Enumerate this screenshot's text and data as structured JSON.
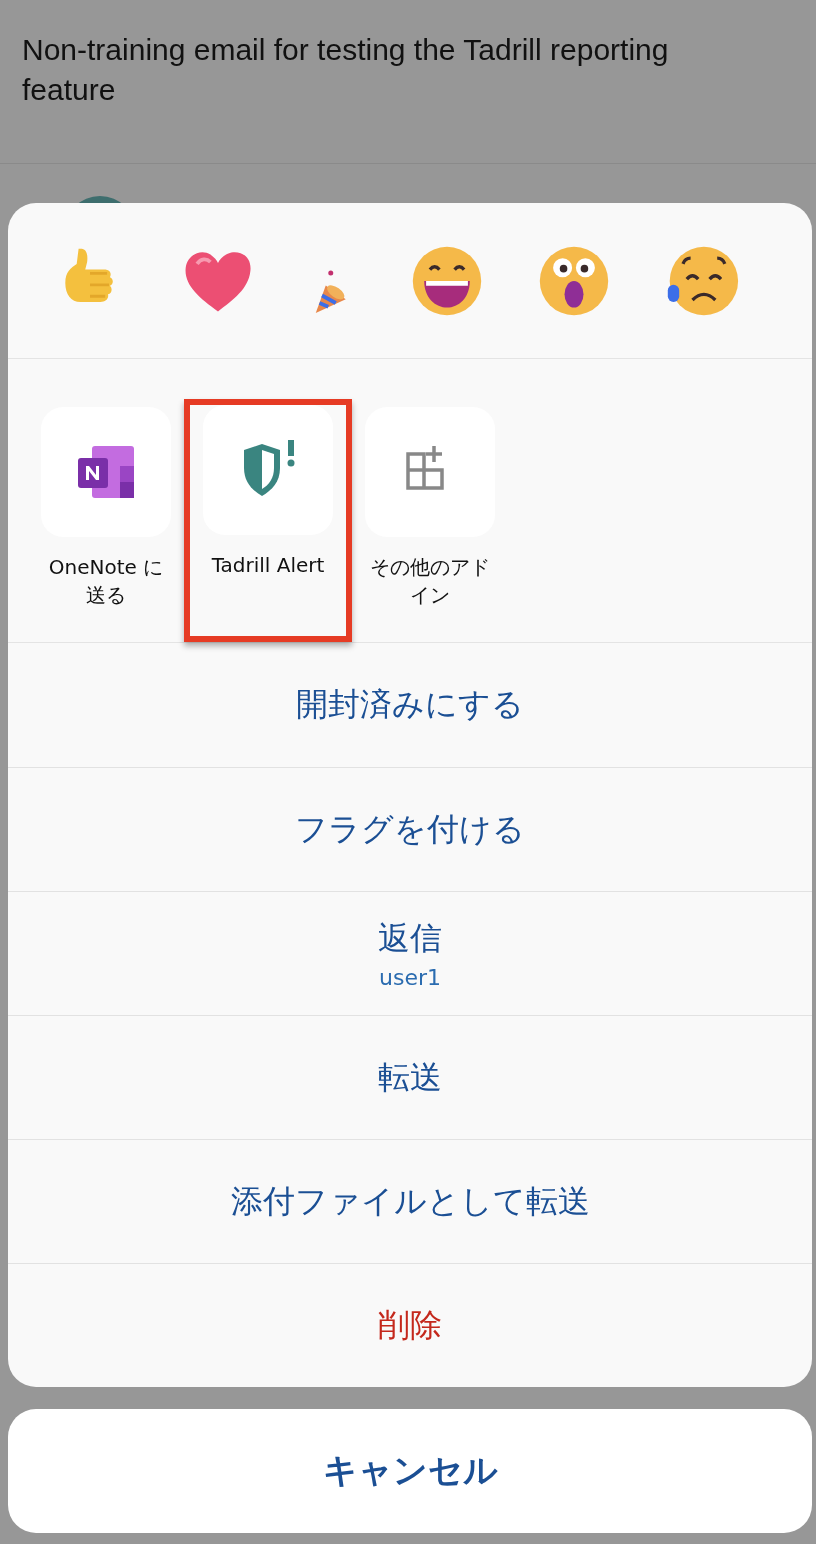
{
  "email": {
    "subject": "Non-training email for testing the Tadrill reporting feature"
  },
  "add_ins": [
    {
      "label": "OneNote に送る",
      "highlighted": false
    },
    {
      "label": "Tadrill Alert",
      "highlighted": true
    },
    {
      "label": "その他のアドイン",
      "highlighted": false
    }
  ],
  "actions": [
    {
      "label": "開封済みにする",
      "kind": "normal"
    },
    {
      "label": "フラグを付ける",
      "kind": "normal"
    },
    {
      "label": "返信",
      "sublabel": "user1",
      "kind": "normal"
    },
    {
      "label": "転送",
      "kind": "normal"
    },
    {
      "label": "添付ファイルとして転送",
      "kind": "normal"
    },
    {
      "label": "削除",
      "kind": "destructive"
    }
  ],
  "cancel": {
    "label": "キャンセル"
  }
}
